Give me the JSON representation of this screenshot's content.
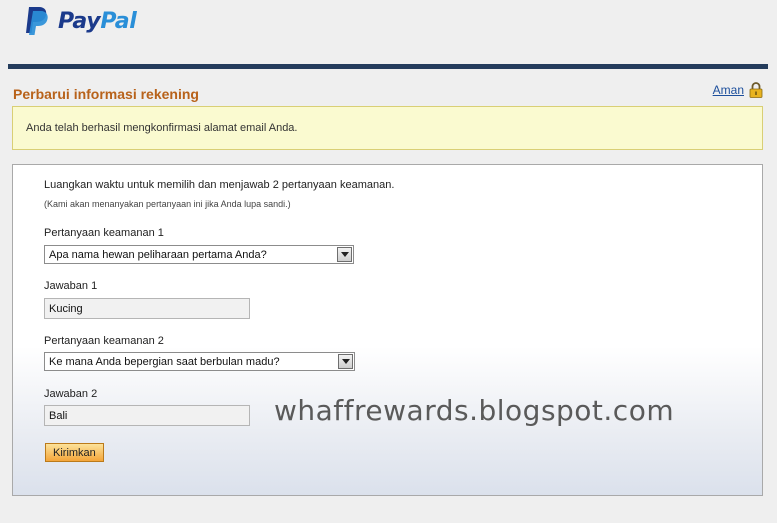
{
  "brand": {
    "pay": "Pay",
    "pal": "Pal"
  },
  "page": {
    "title": "Perbarui informasi rekening",
    "secure_link": "Aman"
  },
  "notice": {
    "text": "Anda telah berhasil mengkonfirmasi alamat email Anda."
  },
  "form": {
    "intro": "Luangkan waktu untuk memilih dan menjawab 2 pertanyaan keamanan.",
    "intro_note": "(Kami akan menanyakan pertanyaan ini jika Anda lupa sandi.)",
    "question1": {
      "label": "Pertanyaan keamanan 1",
      "selected": "Apa nama hewan peliharaan pertama Anda?"
    },
    "answer1": {
      "label": "Jawaban 1",
      "value": "Kucing"
    },
    "question2": {
      "label": "Pertanyaan keamanan 2",
      "selected": "Ke mana Anda bepergian saat berbulan madu?"
    },
    "answer2": {
      "label": "Jawaban 2",
      "value": "Bali"
    },
    "submit_label": "Kirimkan"
  },
  "watermark": "whaffrewards.blogspot.com",
  "colors": {
    "title": "#b8621a",
    "rule": "#243c5c",
    "notice_bg": "#fafad0",
    "button": "#f4a53a",
    "link": "#1d4f9c"
  }
}
